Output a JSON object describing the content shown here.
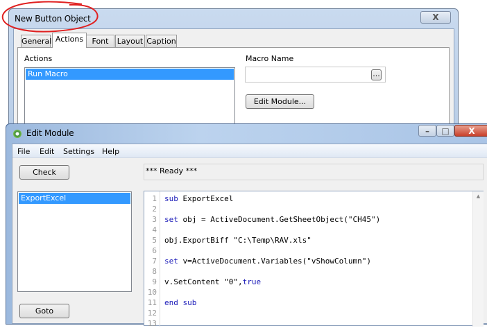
{
  "button_dialog": {
    "title": "New Button Object",
    "close_label": "X",
    "tabs": [
      {
        "label": "General"
      },
      {
        "label": "Actions",
        "active": true
      },
      {
        "label": "Font"
      },
      {
        "label": "Layout"
      },
      {
        "label": "Caption"
      }
    ],
    "actions_label": "Actions",
    "actions": [
      "Run Macro"
    ],
    "macro_name_label": "Macro Name",
    "macro_name_value": "",
    "browse_label": "...",
    "edit_module_label": "Edit Module...",
    "annotation_color": "#e02020"
  },
  "edit_module": {
    "title": "Edit Module",
    "window_buttons": {
      "minimize": "–",
      "maximize": "□",
      "close": "X"
    },
    "menu": [
      "File",
      "Edit",
      "Settings",
      "Help"
    ],
    "check_label": "Check",
    "status": "*** Ready ***",
    "modules": [
      "ExportExcel"
    ],
    "goto_label": "Goto",
    "keyword_color": "#1a1ab8",
    "code_lines": [
      [
        {
          "t": "sub",
          "kw": true
        },
        {
          "t": " ExportExcel"
        }
      ],
      [],
      [
        {
          "t": "set",
          "kw": true
        },
        {
          "t": " obj = ActiveDocument.GetSheetObject(\"CH45\")"
        }
      ],
      [],
      [
        {
          "t": "obj.ExportBiff \"C:\\Temp\\RAV.xls\""
        }
      ],
      [],
      [
        {
          "t": "set",
          "kw": true
        },
        {
          "t": " v=ActiveDocument.Variables(\"vShowColumn\")"
        }
      ],
      [],
      [
        {
          "t": "v.SetContent \"0\","
        },
        {
          "t": "true",
          "kw": true
        }
      ],
      [],
      [
        {
          "t": "end sub",
          "kw": true
        }
      ],
      [],
      []
    ]
  }
}
